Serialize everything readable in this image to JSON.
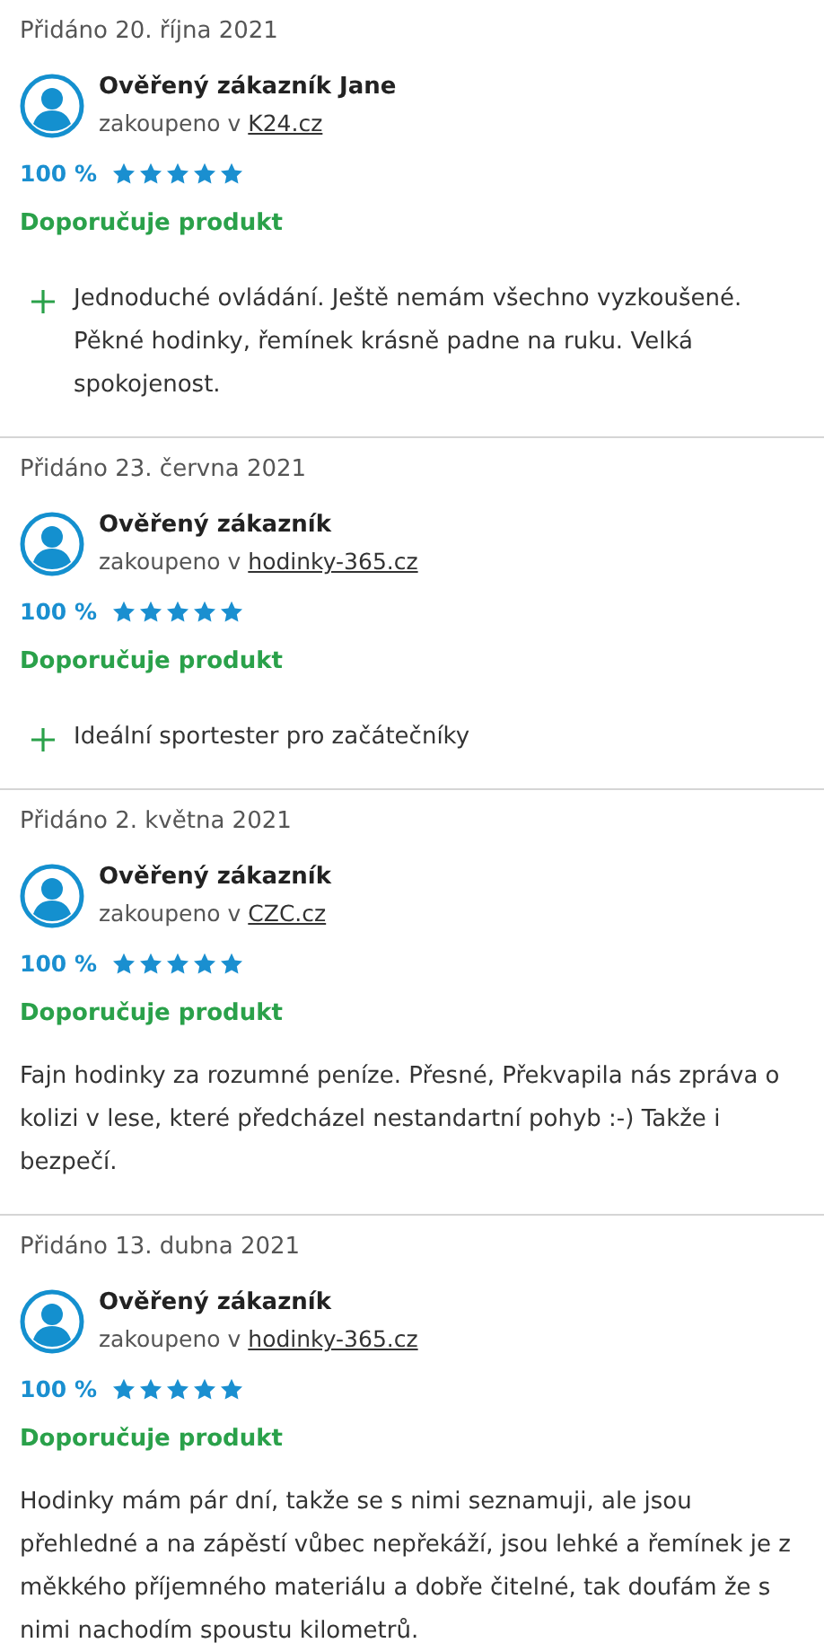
{
  "reviews": [
    {
      "date": "Přidáno 20. října 2021",
      "author": "Ověřený zákazník Jane",
      "bought_prefix": "zakoupeno v",
      "shop": "K24.cz",
      "percent": "100 %",
      "stars": 5,
      "recommend": "Doporučuje produkt",
      "body": {
        "kind": "pros",
        "items": [
          "Jednoduché ovládání. Ještě nemám všechno vyzkoušené. Pěkné hodinky, řemínek krásně padne na ruku. Velká spokojenost."
        ]
      }
    },
    {
      "date": "Přidáno 23. června 2021",
      "author": "Ověřený zákazník",
      "bought_prefix": "zakoupeno v",
      "shop": "hodinky-365.cz",
      "percent": "100 %",
      "stars": 5,
      "recommend": "Doporučuje produkt",
      "body": {
        "kind": "pros",
        "items": [
          "Ideální sportester pro začátečníky"
        ]
      }
    },
    {
      "date": "Přidáno 2. května 2021",
      "author": "Ověřený zákazník",
      "bought_prefix": "zakoupeno v",
      "shop": "CZC.cz",
      "percent": "100 %",
      "stars": 5,
      "recommend": "Doporučuje produkt",
      "body": {
        "kind": "text",
        "text": "Fajn hodinky za rozumné peníze. Přesné, Překvapila nás zpráva o kolizi v lese, které předcházel nestandartní pohyb :-) Takže i bezpečí."
      }
    },
    {
      "date": "Přidáno 13. dubna 2021",
      "author": "Ověřený zákazník",
      "bought_prefix": "zakoupeno v",
      "shop": "hodinky-365.cz",
      "percent": "100 %",
      "stars": 5,
      "recommend": "Doporučuje produkt",
      "body": {
        "kind": "text",
        "text": "Hodinky mám pár dní, takže se s nimi seznamuji, ale jsou přehledné a na zápěstí vůbec nepřekáží, jsou lehké a řemínek je z měkkého příjemného materiálu a dobře čitelné, tak doufám že s nimi nachodím spoustu kilometrů."
      }
    }
  ]
}
